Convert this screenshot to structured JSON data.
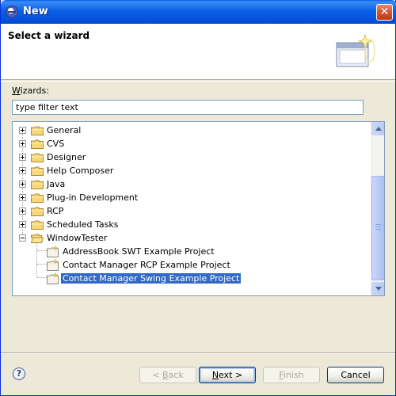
{
  "window": {
    "title": "New"
  },
  "banner": {
    "title": "Select a wizard"
  },
  "wizards": {
    "label_prefix": "W",
    "label_rest": "izards:",
    "filter_value": "type filter text"
  },
  "tree": {
    "items": [
      {
        "label": "General"
      },
      {
        "label": "CVS"
      },
      {
        "label": "Designer"
      },
      {
        "label": "Help Composer"
      },
      {
        "label": "Java"
      },
      {
        "label": "Plug-in Development"
      },
      {
        "label": "RCP"
      },
      {
        "label": "Scheduled Tasks"
      },
      {
        "label": "WindowTester"
      },
      {
        "label": "AddressBook SWT Example Project"
      },
      {
        "label": "Contact Manager RCP Example Project"
      },
      {
        "label": "Contact Manager Swing Example Project"
      }
    ]
  },
  "buttons": {
    "help": "?",
    "back_mnemonic": "< ",
    "back_u": "B",
    "back_rest": "ack",
    "next_u": "N",
    "next_rest": "ext >",
    "finish_u": "F",
    "finish_rest": "inish",
    "cancel": "Cancel"
  },
  "colors": {
    "selection": "#316ac5",
    "titlebar": "#0a5fe6",
    "dialog_bg": "#ece9d8"
  }
}
